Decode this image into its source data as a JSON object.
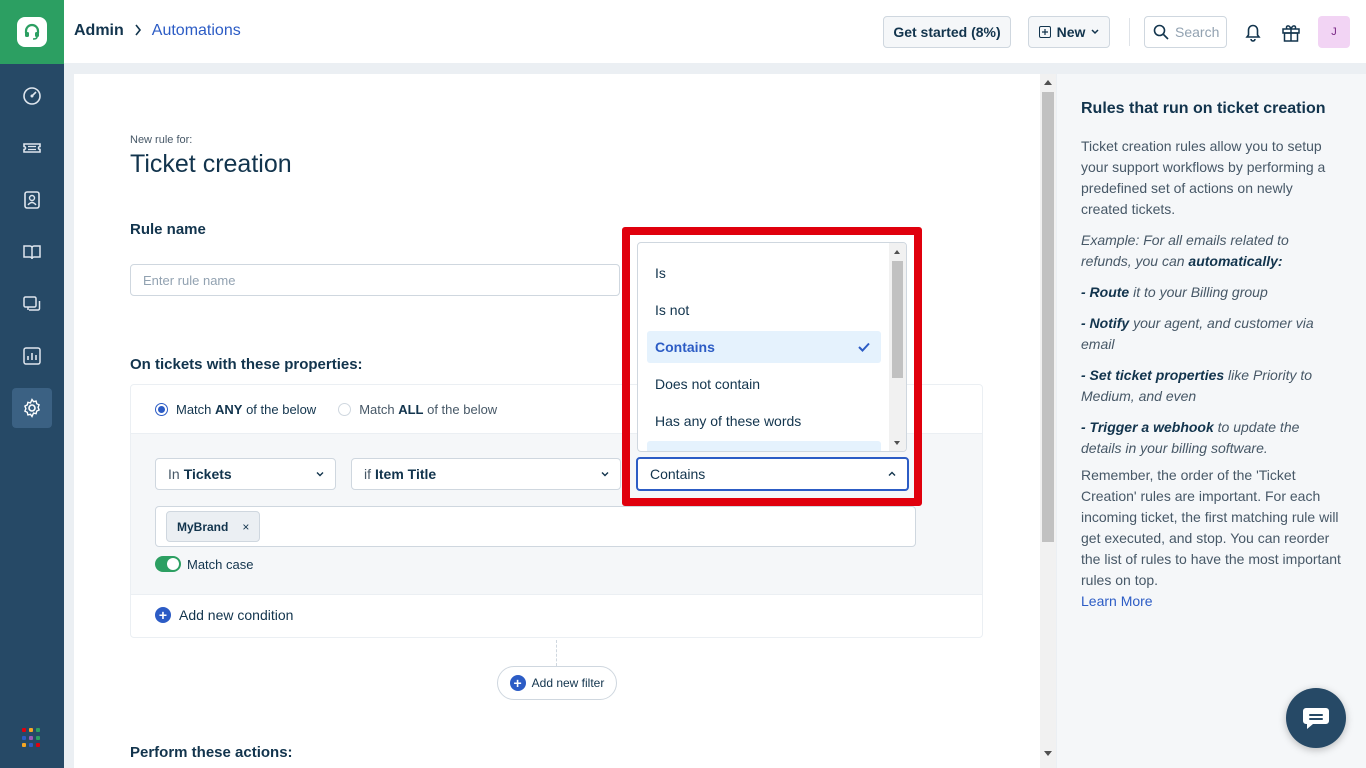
{
  "header": {
    "breadcrumb_admin": "Admin",
    "breadcrumb_sep": ">",
    "breadcrumb_current": "Automations",
    "get_started_label": "Get started (8%)",
    "new_label": "New",
    "search_placeholder": "Search",
    "avatar_initial": "J"
  },
  "page": {
    "subtitle": "New rule for:",
    "title": "Ticket creation",
    "rule_name_label": "Rule name",
    "rule_name_placeholder": "Enter rule name",
    "properties_label": "On tickets with these properties:",
    "match_any_prefix": "Match ",
    "match_any_bold": "ANY",
    "match_any_suffix": " of the below",
    "match_all_prefix": "Match ",
    "match_all_bold": "ALL",
    "match_all_suffix": " of the below",
    "in_prefix": "In",
    "in_value": "Tickets",
    "if_prefix": "if",
    "if_value": "Item Title",
    "operator_value": "Contains",
    "tag_value": "MyBrand",
    "tag_remove": "×",
    "match_case_label": "Match case",
    "add_condition_label": "Add new condition",
    "add_filter_label": "Add new filter",
    "perform_label": "Perform these actions:"
  },
  "dropdown": {
    "options": [
      "Is",
      "Is not",
      "Contains",
      "Does not contain",
      "Has any of these words"
    ],
    "selected": "Contains"
  },
  "right_panel": {
    "title": "Rules that run on ticket creation",
    "intro": "Ticket creation rules allow you to setup your support workflows by performing a predefined set of actions on newly created tickets.",
    "example_prefix": "Example: For all emails related to refunds, you can ",
    "example_bold": "automatically:",
    "route_bold": "- Route",
    "route_text": " it to your Billing group",
    "notify_bold": "- Notify",
    "notify_text": " your agent, and customer via email",
    "set_bold": "- Set ticket properties",
    "set_text": " like Priority to Medium, and even",
    "trigger_bold": "- Trigger a webhook",
    "trigger_text": " to update the details in your billing software.",
    "remember": "Remember, the order of the 'Ticket Creation' rules are important. For each incoming ticket, the first matching rule will get executed, and stop. You can reorder the list of rules to have the most important rules on top.",
    "learn_more": "Learn More"
  },
  "colors": {
    "brand_green": "#2c9f62",
    "nav_bg": "#264966",
    "accent_blue": "#2c5cc5",
    "highlight_red": "#e0000d"
  },
  "icons": {
    "nav": [
      "dashboard-icon",
      "tickets-icon",
      "contacts-icon",
      "solutions-icon",
      "forums-icon",
      "reports-icon",
      "admin-gear-icon"
    ],
    "header": [
      "search-icon",
      "bell-icon",
      "gift-icon"
    ]
  }
}
